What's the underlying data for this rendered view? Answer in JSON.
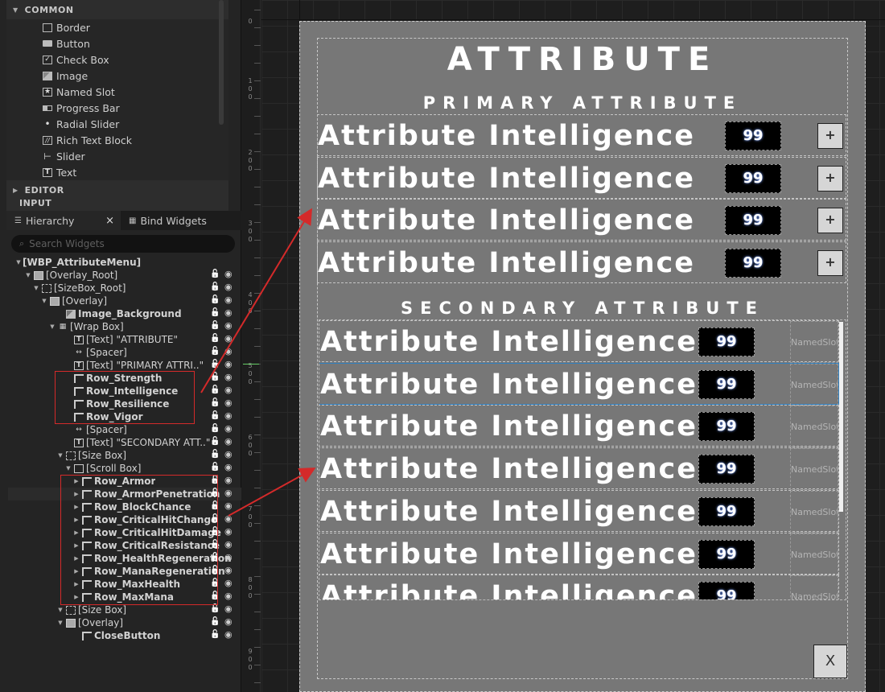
{
  "palette": {
    "categories": [
      {
        "label": "COMMON"
      },
      {
        "label": "EDITOR"
      },
      {
        "label": "INPUT"
      }
    ],
    "items": [
      {
        "label": "Border",
        "icon": "border-icon"
      },
      {
        "label": "Button",
        "icon": "button-icon"
      },
      {
        "label": "Check Box",
        "icon": "checkbox-icon"
      },
      {
        "label": "Image",
        "icon": "image-icon"
      },
      {
        "label": "Named Slot",
        "icon": "named-slot-icon"
      },
      {
        "label": "Progress Bar",
        "icon": "progress-bar-icon"
      },
      {
        "label": "Radial Slider",
        "icon": "radial-slider-icon"
      },
      {
        "label": "Rich Text Block",
        "icon": "rich-text-icon"
      },
      {
        "label": "Slider",
        "icon": "slider-icon"
      },
      {
        "label": "Text",
        "icon": "text-icon"
      }
    ]
  },
  "tabs": {
    "hierarchy": "Hierarchy",
    "bind_widgets": "Bind Widgets"
  },
  "search": {
    "placeholder": "Search Widgets"
  },
  "hierarchy": [
    {
      "label": "[WBP_AttributeMenu]",
      "bold": true
    },
    {
      "label": "[Overlay_Root]"
    },
    {
      "label": "[SizeBox_Root]"
    },
    {
      "label": "[Overlay]"
    },
    {
      "label": "Image_Background",
      "bold": true
    },
    {
      "label": "[Wrap Box]"
    },
    {
      "label": "[Text] \"ATTRIBUTE\""
    },
    {
      "label": "[Spacer]"
    },
    {
      "label": "[Text] \"PRIMARY ATTRI..\""
    },
    {
      "label": "Row_Strength",
      "bold": true
    },
    {
      "label": "Row_Intelligence",
      "bold": true
    },
    {
      "label": "Row_Resilience",
      "bold": true
    },
    {
      "label": "Row_Vigor",
      "bold": true
    },
    {
      "label": "[Spacer]"
    },
    {
      "label": "[Text] \"SECONDARY ATT..\""
    },
    {
      "label": "[Size Box]"
    },
    {
      "label": "[Scroll Box]"
    },
    {
      "label": "Row_Armor",
      "bold": true
    },
    {
      "label": "Row_ArmorPenetration",
      "bold": true
    },
    {
      "label": "Row_BlockChance",
      "bold": true
    },
    {
      "label": "Row_CriticalHitChange",
      "bold": true
    },
    {
      "label": "Row_CriticalHitDamage",
      "bold": true
    },
    {
      "label": "Row_CriticalResistance",
      "bold": true
    },
    {
      "label": "Row_HealthRegeneration",
      "bold": true
    },
    {
      "label": "Row_ManaRegeneration",
      "bold": true
    },
    {
      "label": "Row_MaxHealth",
      "bold": true
    },
    {
      "label": "Row_MaxMana",
      "bold": true
    },
    {
      "label": "[Size Box]"
    },
    {
      "label": "[Overlay]"
    },
    {
      "label": "CloseButton",
      "bold": true
    }
  ],
  "ruler": {
    "labels": [
      "0",
      "1\n0\n0",
      "2\n0\n0",
      "3\n0\n0",
      "4\n0\n0",
      "5\n0\n0",
      "6\n0\n0",
      "7\n0\n0",
      "8\n0\n0",
      "9\n0\n0"
    ]
  },
  "menu": {
    "title": "ATTRIBUTE",
    "primary_title": "PRIMARY ATTRIBUTE",
    "secondary_title": "SECONDARY ATTRIBUTE",
    "primary_rows": [
      {
        "name": "Attribute Intelligence",
        "value": "99",
        "button": "+"
      },
      {
        "name": "Attribute Intelligence",
        "value": "99",
        "button": "+"
      },
      {
        "name": "Attribute Intelligence",
        "value": "99",
        "button": "+"
      },
      {
        "name": "Attribute Intelligence",
        "value": "99",
        "button": "+"
      }
    ],
    "secondary_rows": [
      {
        "name": "Attribute Intelligence",
        "value": "99",
        "slot": "NamedSlot"
      },
      {
        "name": "Attribute Intelligence",
        "value": "99",
        "slot": "NamedSlot"
      },
      {
        "name": "Attribute Intelligence",
        "value": "99",
        "slot": "NamedSlot"
      },
      {
        "name": "Attribute Intelligence",
        "value": "99",
        "slot": "NamedSlot"
      },
      {
        "name": "Attribute Intelligence",
        "value": "99",
        "slot": "NamedSlot"
      },
      {
        "name": "Attribute Intelligence",
        "value": "99",
        "slot": "NamedSlot"
      },
      {
        "name": "Attribute Intelligence",
        "value": "99",
        "slot": "NamedSlot"
      }
    ],
    "close_label": "X"
  },
  "colors": {
    "annotation": "#d42a2a",
    "selection": "#2f7fbf",
    "widget_bg": "#777777"
  }
}
